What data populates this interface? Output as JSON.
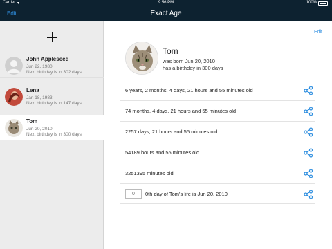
{
  "status_bar": {
    "carrier": "Carrier",
    "time": "9:56 PM",
    "battery": "100%",
    "battery_level": 1.0
  },
  "nav": {
    "title": "Exact Age",
    "edit_label": "Edit"
  },
  "sidebar": {
    "add_icon": "plus-icon",
    "people": [
      {
        "name": "John Appleseed",
        "date": "Jun 22, 1980",
        "next": "Next birthday is in 302 days",
        "avatar": "default-person-icon"
      },
      {
        "name": "Lena",
        "date": "Jan 18, 1983",
        "next": "Next birthday is in 147 days",
        "avatar": "photo-avatar"
      },
      {
        "name": "Tom",
        "date": "Jun 20, 2010",
        "next": "Next birthday is in 300 days",
        "avatar": "cat-avatar",
        "selected": true
      }
    ]
  },
  "detail": {
    "edit_label": "Edit",
    "name": "Tom",
    "born": "was born Jun 20, 2010",
    "birthday": "has a birthday in 300 days",
    "rows": [
      {
        "text": "6 years, 2 months, 4 days, 21 hours and 55 minutes old"
      },
      {
        "text": "74 months, 4 days, 21 hours and 55 minutes old"
      },
      {
        "text": "2257 days, 21 hours and 55 minutes old"
      },
      {
        "text": "54189 hours and 55 minutes old"
      },
      {
        "text": "3251395 minutes old"
      }
    ],
    "day_query": {
      "placeholder": "0",
      "text": "0th day of Tom's life is Jun 20, 2010"
    },
    "share_icon": "share-icon",
    "accent": "#2f8fe0"
  }
}
